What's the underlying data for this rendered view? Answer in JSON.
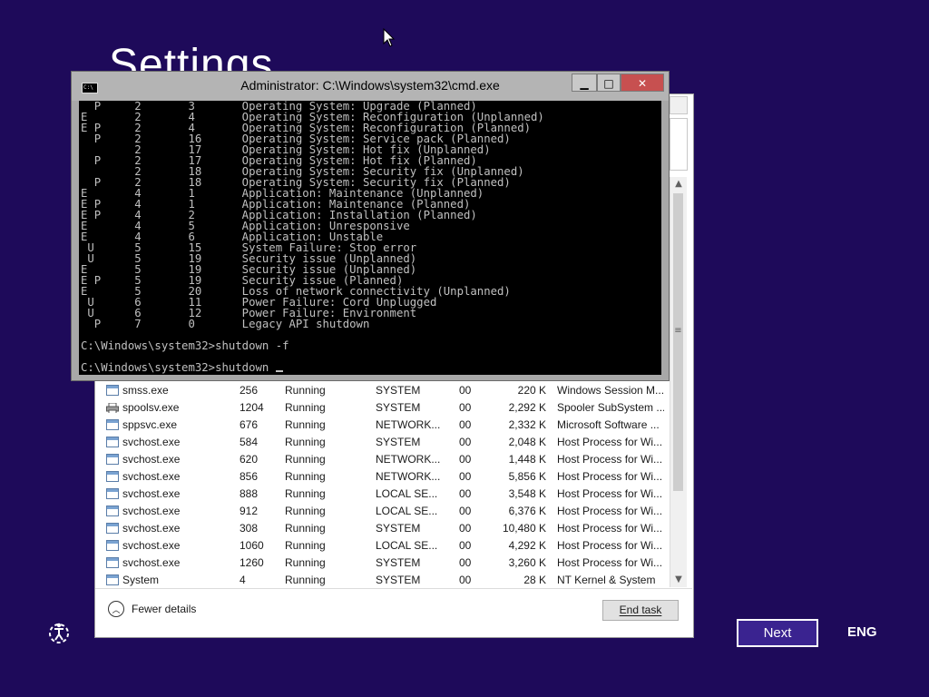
{
  "background": {
    "title": "Settings",
    "color": "#1e0a5a"
  },
  "cmd": {
    "title": "Administrator: C:\\Windows\\system32\\cmd.exe",
    "icon": "cmd-console-icon",
    "lines": [
      "  P     2       3       Operating System: Upgrade (Planned)",
      "E       2       4       Operating System: Reconfiguration (Unplanned)",
      "E P     2       4       Operating System: Reconfiguration (Planned)",
      "  P     2       16      Operating System: Service pack (Planned)",
      "        2       17      Operating System: Hot fix (Unplanned)",
      "  P     2       17      Operating System: Hot fix (Planned)",
      "        2       18      Operating System: Security fix (Unplanned)",
      "  P     2       18      Operating System: Security fix (Planned)",
      "E       4       1       Application: Maintenance (Unplanned)",
      "E P     4       1       Application: Maintenance (Planned)",
      "E P     4       2       Application: Installation (Planned)",
      "E       4       5       Application: Unresponsive",
      "E       4       6       Application: Unstable",
      " U      5       15      System Failure: Stop error",
      " U      5       19      Security issue (Unplanned)",
      "E       5       19      Security issue (Unplanned)",
      "E P     5       19      Security issue (Planned)",
      "E       5       20      Loss of network connectivity (Unplanned)",
      " U      6       11      Power Failure: Cord Unplugged",
      " U      6       12      Power Failure: Environment",
      "  P     7       0       Legacy API shutdown",
      "",
      "C:\\Windows\\system32>shutdown -f",
      ""
    ],
    "prompt": "C:\\Windows\\system32>shutdown "
  },
  "taskmgr": {
    "rows": [
      {
        "name": "smss.exe",
        "pid": "256",
        "status": "Running",
        "user": "SYSTEM",
        "cpu": "00",
        "mem": "220 K",
        "desc": "Windows Session M...",
        "icon": "app-window-icon"
      },
      {
        "name": "spoolsv.exe",
        "pid": "1204",
        "status": "Running",
        "user": "SYSTEM",
        "cpu": "00",
        "mem": "2,292 K",
        "desc": "Spooler SubSystem ...",
        "icon": "printer-icon"
      },
      {
        "name": "sppsvc.exe",
        "pid": "676",
        "status": "Running",
        "user": "NETWORK...",
        "cpu": "00",
        "mem": "2,332 K",
        "desc": "Microsoft Software ...",
        "icon": "app-window-icon"
      },
      {
        "name": "svchost.exe",
        "pid": "584",
        "status": "Running",
        "user": "SYSTEM",
        "cpu": "00",
        "mem": "2,048 K",
        "desc": "Host Process for Wi...",
        "icon": "app-window-icon"
      },
      {
        "name": "svchost.exe",
        "pid": "620",
        "status": "Running",
        "user": "NETWORK...",
        "cpu": "00",
        "mem": "1,448 K",
        "desc": "Host Process for Wi...",
        "icon": "app-window-icon"
      },
      {
        "name": "svchost.exe",
        "pid": "856",
        "status": "Running",
        "user": "NETWORK...",
        "cpu": "00",
        "mem": "5,856 K",
        "desc": "Host Process for Wi...",
        "icon": "app-window-icon"
      },
      {
        "name": "svchost.exe",
        "pid": "888",
        "status": "Running",
        "user": "LOCAL SE...",
        "cpu": "00",
        "mem": "3,548 K",
        "desc": "Host Process for Wi...",
        "icon": "app-window-icon"
      },
      {
        "name": "svchost.exe",
        "pid": "912",
        "status": "Running",
        "user": "LOCAL SE...",
        "cpu": "00",
        "mem": "6,376 K",
        "desc": "Host Process for Wi...",
        "icon": "app-window-icon"
      },
      {
        "name": "svchost.exe",
        "pid": "308",
        "status": "Running",
        "user": "SYSTEM",
        "cpu": "00",
        "mem": "10,480 K",
        "desc": "Host Process for Wi...",
        "icon": "app-window-icon"
      },
      {
        "name": "svchost.exe",
        "pid": "1060",
        "status": "Running",
        "user": "LOCAL SE...",
        "cpu": "00",
        "mem": "4,292 K",
        "desc": "Host Process for Wi...",
        "icon": "app-window-icon"
      },
      {
        "name": "svchost.exe",
        "pid": "1260",
        "status": "Running",
        "user": "SYSTEM",
        "cpu": "00",
        "mem": "3,260 K",
        "desc": "Host Process for Wi...",
        "icon": "app-window-icon"
      },
      {
        "name": "System",
        "pid": "4",
        "status": "Running",
        "user": "SYSTEM",
        "cpu": "00",
        "mem": "28 K",
        "desc": "NT Kernel & System",
        "icon": "app-window-icon"
      }
    ],
    "fewer_details": "Fewer details",
    "end_task": "End task"
  },
  "setup": {
    "next_label": "Next",
    "language": "ENG",
    "next_border_color": "#ffffff",
    "accessibility_icon": "ease-of-access-icon"
  }
}
